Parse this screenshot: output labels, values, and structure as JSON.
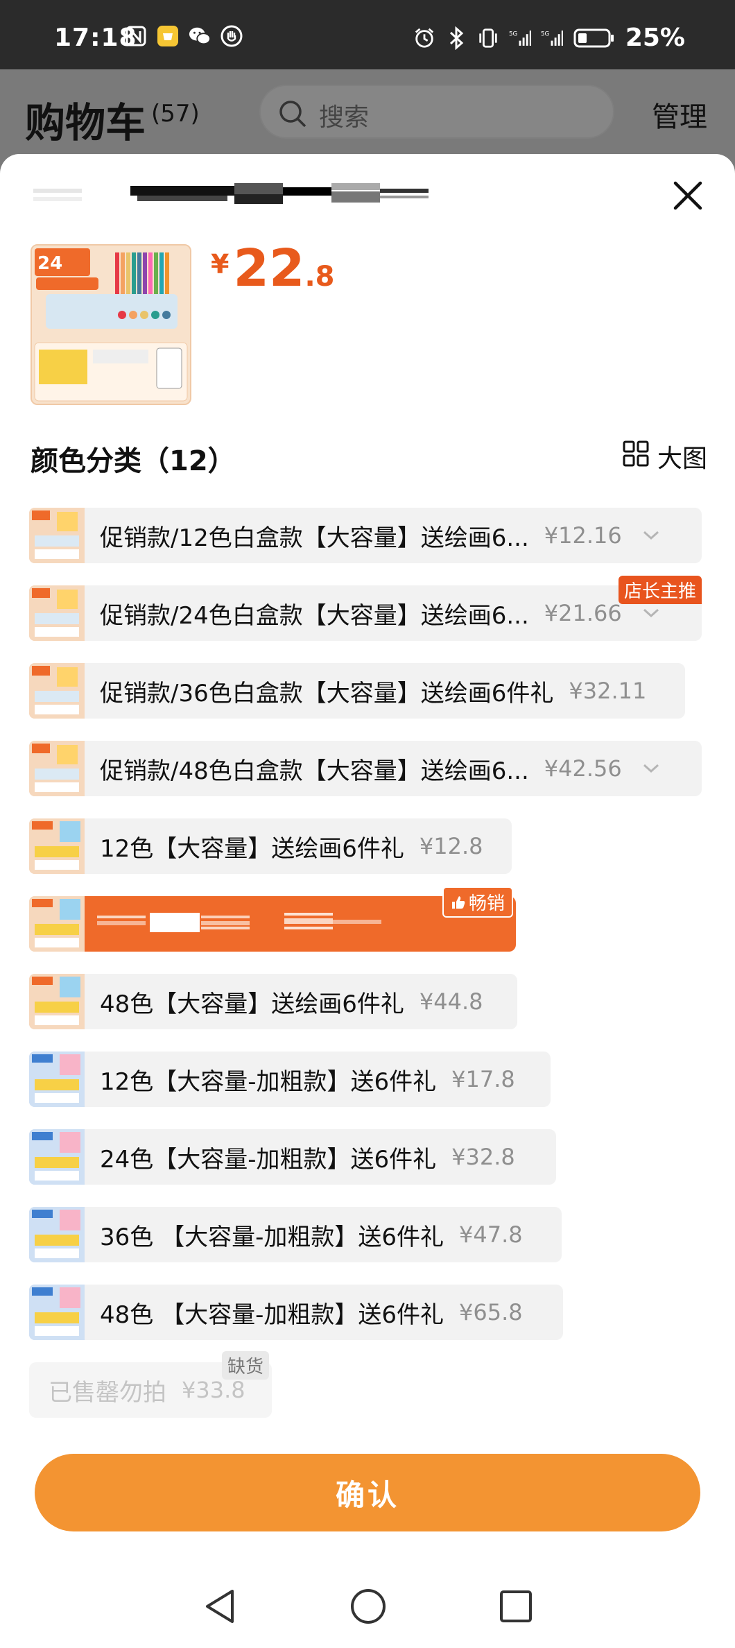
{
  "status_bar": {
    "time": "17:18",
    "battery": "25%",
    "left_icons": [
      "nfc-icon",
      "app-notification-icon",
      "wechat-icon",
      "hand-icon"
    ],
    "right_icons": [
      "alarm-icon",
      "bluetooth-icon",
      "vibrate-icon",
      "signal-5g-icon",
      "signal-5g-icon",
      "battery-icon"
    ]
  },
  "background": {
    "title": "购物车",
    "count": "(57)",
    "search_placeholder": "搜索",
    "manage": "管理"
  },
  "sheet": {
    "price": {
      "symbol": "¥",
      "integer": "22",
      "decimal": ".8"
    },
    "section_title": "颜色分类（12）",
    "view_toggle_label": "大图",
    "confirm": "确认",
    "options": [
      {
        "label": "促销款/12色白盒款【大容量】送绘画6...",
        "price": "¥12.16",
        "dropdown": true
      },
      {
        "label": "促销款/24色白盒款【大容量】送绘画6...",
        "price": "¥21.66",
        "dropdown": true,
        "badge": "店长主推"
      },
      {
        "label": "促销款/36色白盒款【大容量】送绘画6件礼",
        "price": "¥32.11",
        "dropdown": false
      },
      {
        "label": "促销款/48色白盒款【大容量】送绘画6...",
        "price": "¥42.56",
        "dropdown": true
      },
      {
        "label": "12色【大容量】送绘画6件礼",
        "price": "¥12.8",
        "dropdown": false
      },
      {
        "label": "",
        "price": "",
        "selected": true,
        "badge": "畅销"
      },
      {
        "label": "48色【大容量】送绘画6件礼",
        "price": "¥44.8",
        "dropdown": false
      },
      {
        "label": "12色【大容量-加粗款】送6件礼",
        "price": "¥17.8",
        "dropdown": false
      },
      {
        "label": "24色【大容量-加粗款】送6件礼",
        "price": "¥32.8",
        "dropdown": false
      },
      {
        "label": "36色 【大容量-加粗款】送6件礼",
        "price": "¥47.8",
        "dropdown": false
      },
      {
        "label": "48色 【大容量-加粗款】送6件礼",
        "price": "¥65.8",
        "dropdown": false
      },
      {
        "label": "已售罄勿拍",
        "price": "¥33.8",
        "disabled": true,
        "badge": "缺货"
      }
    ]
  },
  "colors": {
    "accent": "#e85a1c",
    "selected_bg": "#ef6a2a",
    "confirm_bg": "#f39432",
    "option_bg": "#f2f2f2",
    "status_bar_bg": "#2b2b2b"
  }
}
